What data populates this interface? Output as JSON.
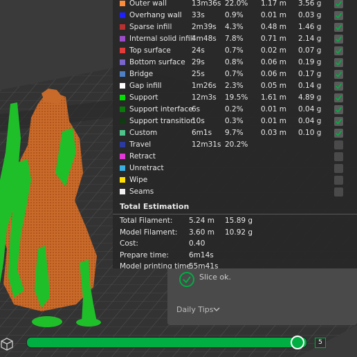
{
  "legend": [
    {
      "name": "Outer wall",
      "time": "13m36s",
      "percent": "22.0%",
      "length": "1.17 m",
      "weight": "3.56 g",
      "color": "#ff8c3a",
      "checked": true
    },
    {
      "name": "Overhang wall",
      "time": "33s",
      "percent": "0.9%",
      "length": "0.01 m",
      "weight": "0.03 g",
      "color": "#1f1fff",
      "checked": true
    },
    {
      "name": "Sparse infill",
      "time": "2m39s",
      "percent": "4.3%",
      "length": "0.48 m",
      "weight": "1.46 g",
      "color": "#b83030",
      "checked": true
    },
    {
      "name": "Internal solid infill",
      "time": "4m48s",
      "percent": "7.8%",
      "length": "0.71 m",
      "weight": "2.14 g",
      "color": "#9b4dc9",
      "checked": true
    },
    {
      "name": "Top surface",
      "time": "24s",
      "percent": "0.7%",
      "length": "0.02 m",
      "weight": "0.07 g",
      "color": "#e33a3a",
      "checked": true
    },
    {
      "name": "Bottom surface",
      "time": "29s",
      "percent": "0.8%",
      "length": "0.06 m",
      "weight": "0.19 g",
      "color": "#7a66cc",
      "checked": true
    },
    {
      "name": "Bridge",
      "time": "25s",
      "percent": "0.7%",
      "length": "0.06 m",
      "weight": "0.17 g",
      "color": "#4f7fc4",
      "checked": true
    },
    {
      "name": "Gap infill",
      "time": "1m26s",
      "percent": "2.3%",
      "length": "0.05 m",
      "weight": "0.14 g",
      "color": "#ffffff",
      "checked": true
    },
    {
      "name": "Support",
      "time": "12m3s",
      "percent": "19.5%",
      "length": "1.61 m",
      "weight": "4.89 g",
      "color": "#00e000",
      "checked": true
    },
    {
      "name": "Support interface",
      "time": "6s",
      "percent": "0.2%",
      "length": "0.01 m",
      "weight": "0.04 g",
      "color": "#0a7a0a",
      "checked": true
    },
    {
      "name": "Support transition",
      "time": "10s",
      "percent": "0.3%",
      "length": "0.01 m",
      "weight": "0.04 g",
      "color": "#103a10",
      "checked": true
    },
    {
      "name": "Custom",
      "time": "6m1s",
      "percent": "9.7%",
      "length": "0.03 m",
      "weight": "0.10 g",
      "color": "#4fc48a",
      "checked": true
    },
    {
      "name": "Travel",
      "time": "12m31s",
      "percent": "20.2%",
      "length": "",
      "weight": "",
      "color": "#2a3aa0",
      "checked": false
    },
    {
      "name": "Retract",
      "time": "",
      "percent": "",
      "length": "",
      "weight": "",
      "color": "#e23ad6",
      "checked": false
    },
    {
      "name": "Unretract",
      "time": "",
      "percent": "",
      "length": "",
      "weight": "",
      "color": "#3aaee0",
      "checked": false
    },
    {
      "name": "Wipe",
      "time": "",
      "percent": "",
      "length": "",
      "weight": "",
      "color": "#ffe000",
      "checked": false
    },
    {
      "name": "Seams",
      "time": "",
      "percent": "",
      "length": "",
      "weight": "",
      "color": "#f0f0f0",
      "checked": false
    }
  ],
  "estimation": {
    "title": "Total Estimation",
    "rows": [
      {
        "label": "Total Filament:",
        "v1": "5.24 m",
        "v2": "15.89 g"
      },
      {
        "label": "Model Filament:",
        "v1": "3.60 m",
        "v2": "10.92 g"
      },
      {
        "label": "Cost:",
        "v1": "0.40",
        "v2": ""
      },
      {
        "label": "Prepare time:",
        "v1": "6m14s",
        "v2": ""
      },
      {
        "label": "Model printing time:",
        "v1": "55m41s",
        "v2": ""
      }
    ]
  },
  "notification": {
    "status": "Slice ok.",
    "tips_label": "Daily Tips"
  },
  "slider": {
    "layer": "5",
    "progress": 0.97
  },
  "colors": {
    "accent": "#00ae42",
    "panel": "#282828"
  }
}
